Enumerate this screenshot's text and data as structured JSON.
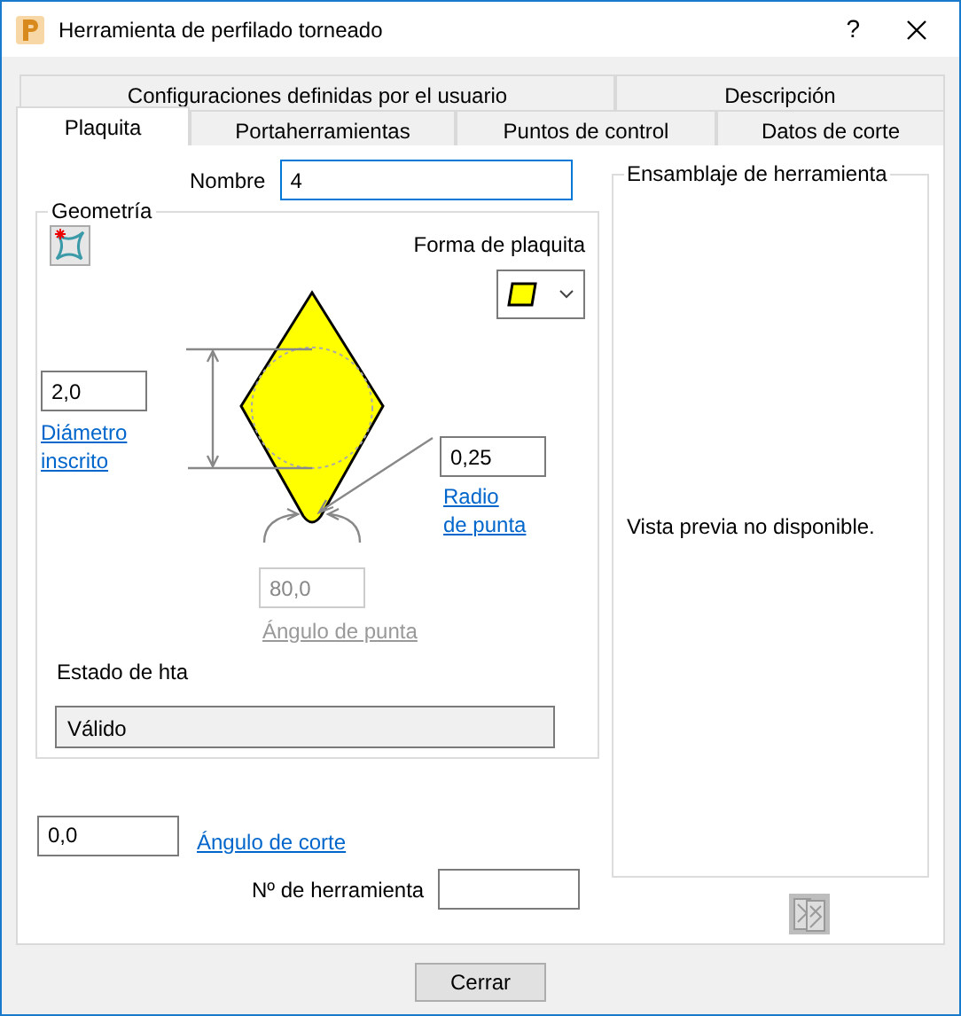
{
  "window": {
    "title": "Herramienta de perfilado torneado",
    "help": "?"
  },
  "tab_rows": [
    [
      {
        "label": "Configuraciones definidas por el usuario",
        "selected": false
      },
      {
        "label": "Descripción",
        "selected": false
      }
    ],
    [
      {
        "label": "Plaquita",
        "selected": true
      },
      {
        "label": "Portaherramientas",
        "selected": false
      },
      {
        "label": "Puntos de control",
        "selected": false
      },
      {
        "label": "Datos de corte",
        "selected": false
      }
    ]
  ],
  "name": {
    "label": "Nombre",
    "value": "4"
  },
  "geometry": {
    "title": "Geometría",
    "shape_label": "Forma de plaquita",
    "inscribed_diameter": {
      "value": "2,0",
      "link": "Diámetro inscrito"
    },
    "nose_radius": {
      "value": "0,25",
      "link_lines": [
        "Radio",
        "de punta"
      ]
    },
    "tip_angle": {
      "value": "80,0",
      "label": "Ángulo de punta",
      "disabled": true
    },
    "status_label": "Estado de hta",
    "status": "Válido"
  },
  "cut_angle": {
    "value": "0,0",
    "link": "Ángulo de corte"
  },
  "tool_number": {
    "label": "Nº de herramienta"
  },
  "assembly": {
    "title": "Ensamblaje de herramienta",
    "message": "Vista previa no disponible."
  },
  "buttons": [
    "Cerrar"
  ]
}
